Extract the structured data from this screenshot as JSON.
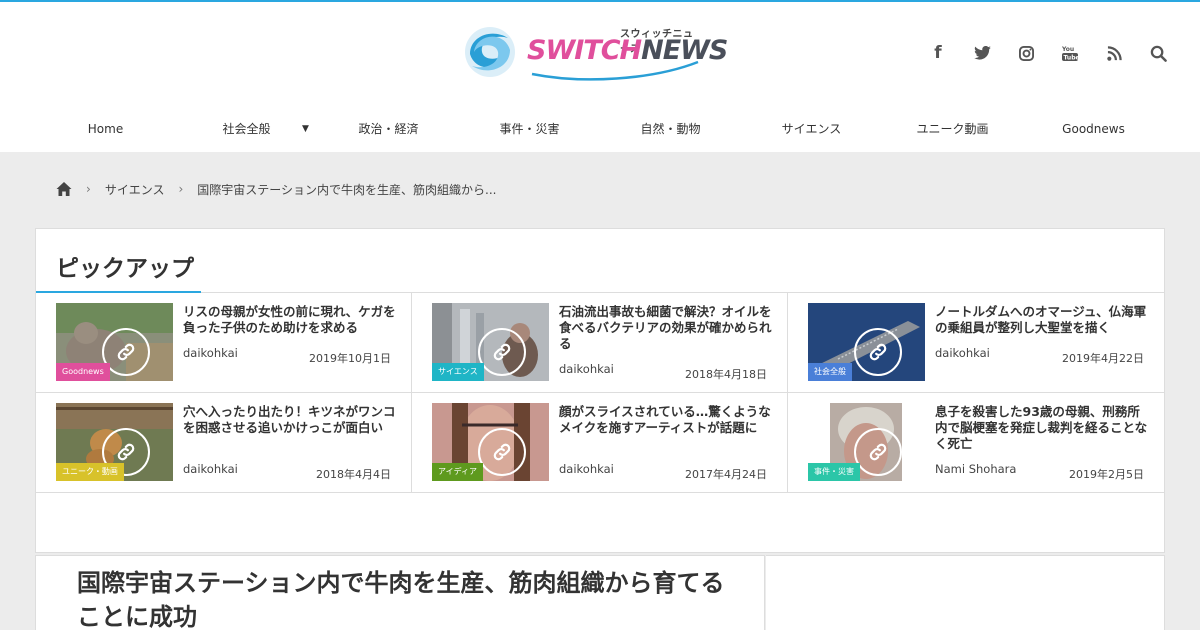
{
  "header": {
    "logo_word_1": "SWITCH",
    "logo_word_2": "NEWS",
    "logo_kana": "スウィッチニュース",
    "socials": [
      {
        "icon": "facebook-icon",
        "glyph": "f"
      },
      {
        "icon": "twitter-icon",
        "glyph": "🐦"
      },
      {
        "icon": "instagram-icon",
        "glyph": "◎"
      },
      {
        "icon": "youtube-icon",
        "glyph": "▶"
      },
      {
        "icon": "rss-icon",
        "glyph": ")"
      },
      {
        "icon": "search-icon",
        "glyph": "⌕"
      }
    ]
  },
  "nav": {
    "items": [
      "Home",
      "社会全般",
      "政治・経済",
      "事件・災害",
      "自然・動物",
      "サイエンス",
      "ユニーク動画",
      "Goodnews"
    ],
    "caret": "▼"
  },
  "breadcrumb": {
    "category": "サイエンス",
    "current": "国際宇宙ステーション内で牛肉を生産、筋肉組織から...",
    "separator": "›"
  },
  "pickup": {
    "heading": "ピックアップ",
    "cards": [
      {
        "title": "リスの母親が女性の前に現れ、ケガを負った子供のため助けを求める",
        "author": "daikohkai",
        "date": "2019年10月1日",
        "category": "Goodnews",
        "cat_color": "#e04f9c"
      },
      {
        "title": "石油流出事故も細菌で解決？オイルを食べるバクテリアの効果が確かめられる",
        "author": "daikohkai",
        "date": "2018年4月18日",
        "category": "サイエンス",
        "cat_color": "#1fb5c6"
      },
      {
        "title": "ノートルダムへのオマージュ、仏海軍の乗組員が整列し大聖堂を描く",
        "author": "daikohkai",
        "date": "2019年4月22日",
        "category": "社会全般",
        "cat_color": "#4a7fd8"
      },
      {
        "title": "穴へ入ったり出たり！キツネがワンコを困惑させる追いかけっこが面白い",
        "author": "daikohkai",
        "date": "2018年4月4日",
        "category": "ユニーク・動画",
        "cat_color": "#d8c22a"
      },
      {
        "title": "顔がスライスされている…驚くようなメイクを施すアーティストが話題に",
        "author": "daikohkai",
        "date": "2017年4月24日",
        "category": "アイディア",
        "cat_color": "#5e9a1e"
      },
      {
        "title": "息子を殺害した93歳の母親、刑務所内で脳梗塞を発症し裁判を経ることなく死亡",
        "author": "Nami Shohara",
        "date": "2019年2月5日",
        "category": "事件・災害",
        "cat_color": "#2bc6a8"
      }
    ]
  },
  "article": {
    "title": "国際宇宙ステーション内で牛肉を生産、筋肉組織から育てることに成功"
  },
  "colors": {
    "accent": "#2aa7e0",
    "brand_pink": "#e04f9c"
  }
}
